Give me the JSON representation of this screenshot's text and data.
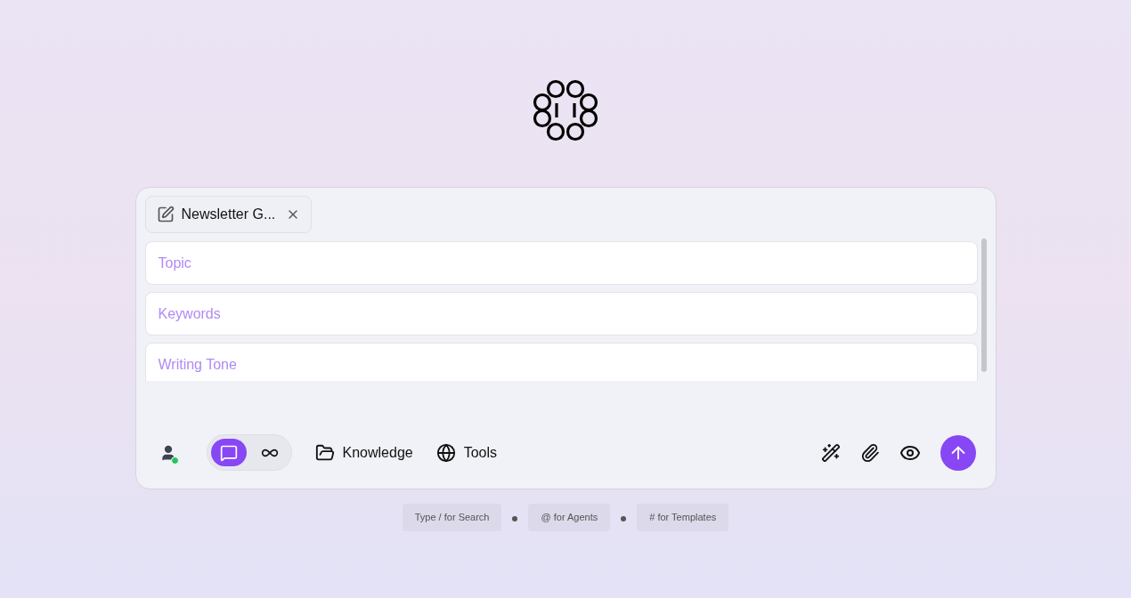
{
  "template_chip": {
    "label": "Newsletter G..."
  },
  "fields": [
    {
      "placeholder": "Topic"
    },
    {
      "placeholder": "Keywords"
    },
    {
      "placeholder": "Writing Tone"
    }
  ],
  "modes": [
    {
      "kind": "chat",
      "selected": true
    },
    {
      "kind": "infinite",
      "selected": false
    }
  ],
  "user_status": {
    "online": true
  },
  "toolbar_buttons": [
    {
      "kind": "knowledge",
      "label": "Knowledge"
    },
    {
      "kind": "tools",
      "label": "Tools"
    }
  ],
  "hints": [
    "Type / for Search",
    "@ for Agents",
    "# for Templates"
  ]
}
